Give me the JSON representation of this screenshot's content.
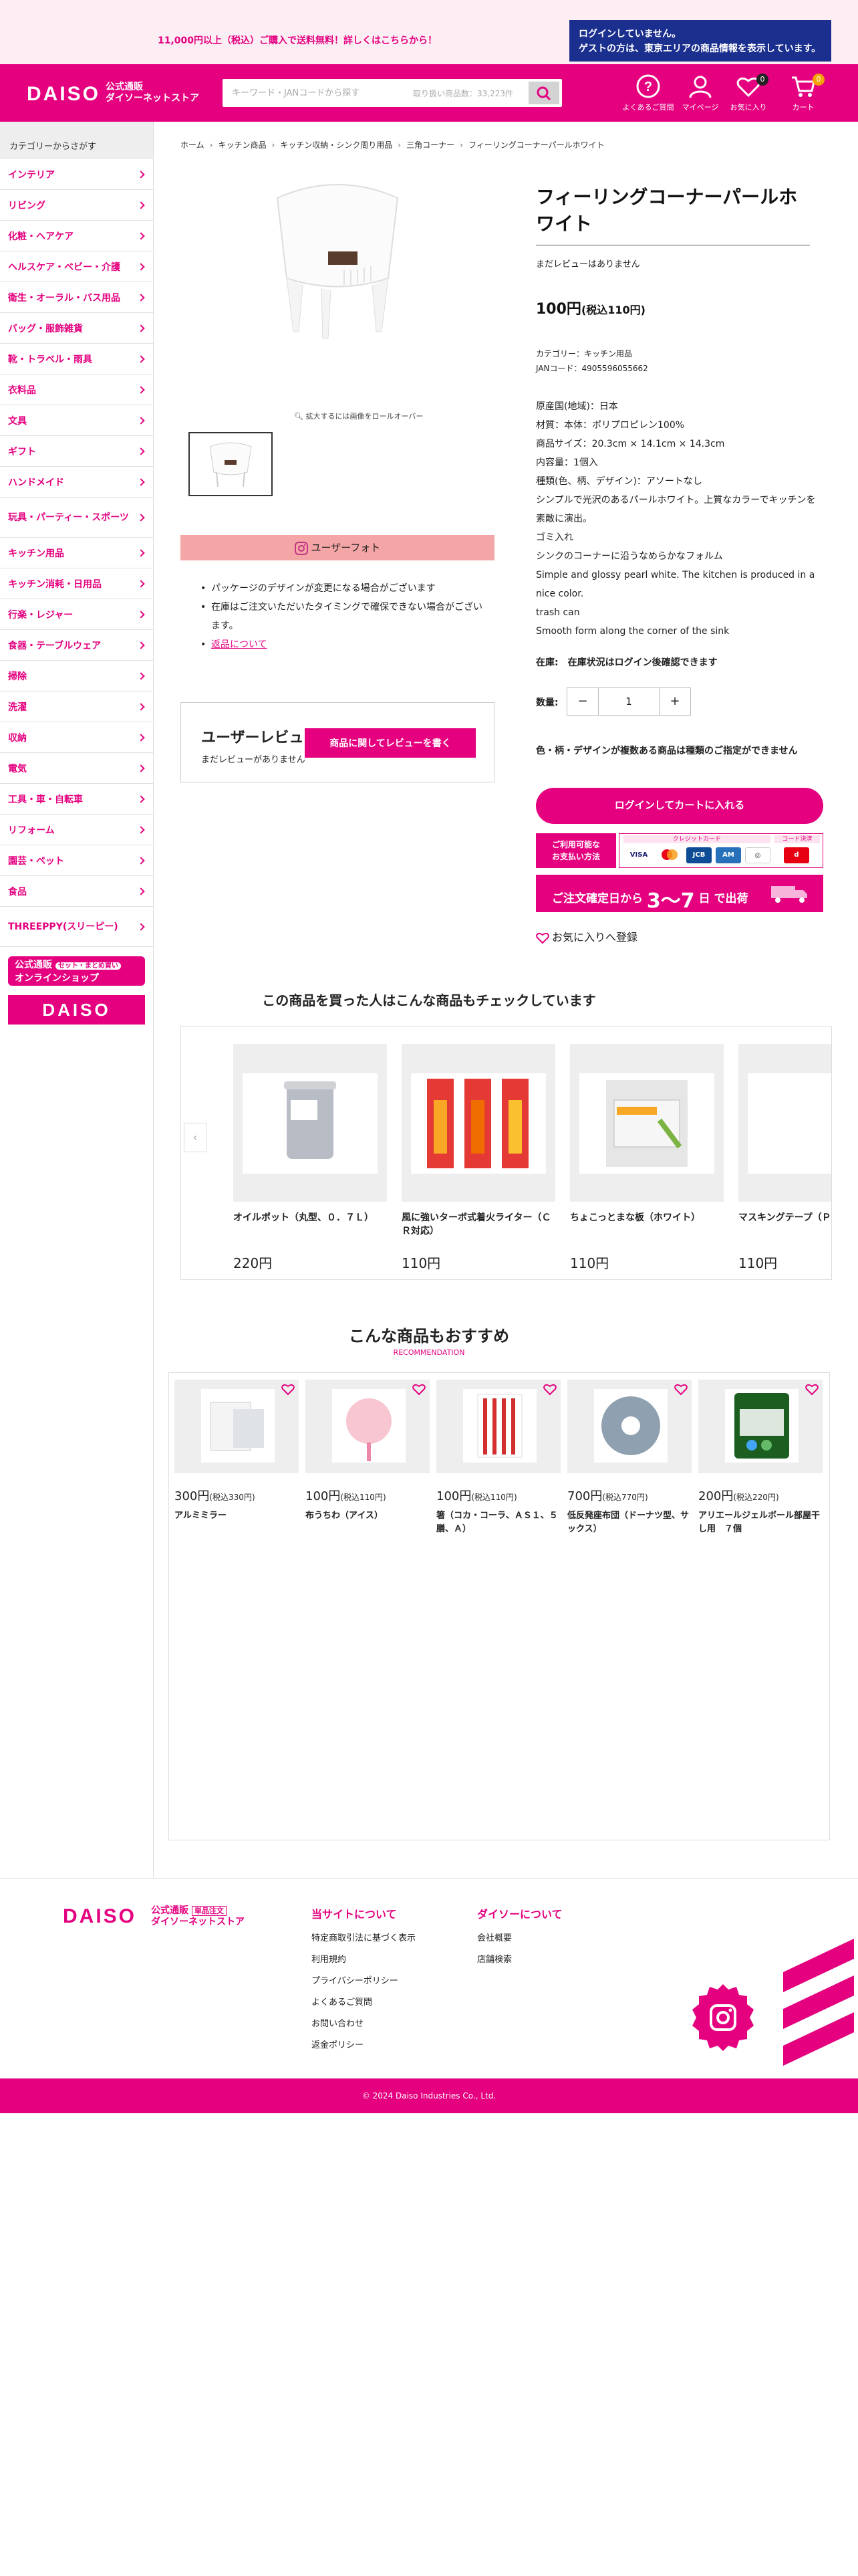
{
  "notice": {
    "shipping": "11,000円以上（税込）ご購入で送料無料！詳しくはこちらから！",
    "login_line1": "ログインしていません。",
    "login_line2": "ゲストの方は、東京エリアの商品情報を表示しています。"
  },
  "header": {
    "logo": "DAISO",
    "logo_sub1": "公式通販",
    "logo_sub2": "ダイソーネットストア",
    "search_placeholder": "キーワード・JANコードから探す",
    "search_hint": "取り扱い商品数：33,223件",
    "icons": [
      {
        "label": "よくあるご質問",
        "icon": "question-icon"
      },
      {
        "label": "マイページ",
        "icon": "user-icon"
      },
      {
        "label": "お気に入り",
        "icon": "heart-icon",
        "badge": "0"
      },
      {
        "label": "カート",
        "icon": "cart-icon",
        "badge": "0"
      }
    ]
  },
  "sidebar": {
    "heading": "カテゴリーからさがす",
    "items": [
      "インテリア",
      "リビング",
      "化粧・ヘアケア",
      "ヘルスケア・ベビー・介護",
      "衛生・オーラル・バス用品",
      "バッグ・服飾雑貨",
      "靴・トラベル・雨具",
      "衣料品",
      "文具",
      "ギフト",
      "ハンドメイド",
      "玩具・パーティー・スポーツ",
      "キッチン用品",
      "キッチン消耗・日用品",
      "行楽・レジャー",
      "食器・テーブルウェア",
      "掃除",
      "洗濯",
      "収納",
      "電気",
      "工具・車・自転車",
      "リフォーム",
      "園芸・ペット",
      "食品",
      "THREEPPY(スリーピー)"
    ],
    "banner1_line1": "公式通販",
    "banner1_tag": "セット・まとめ買い",
    "banner1_line2": "オンラインショップ",
    "banner2": "DAISO"
  },
  "breadcrumb": [
    "ホーム",
    "キッチン商品",
    "キッチン収納・シンク周り用品",
    "三角コーナー",
    "フィーリングコーナーパールホワイト"
  ],
  "gallery": {
    "zoom_hint": "拡大するには画像をロールオーバー",
    "user_photo": "ユーザーフォト"
  },
  "notes": {
    "item1": "パッケージのデザインが変更になる場合がございます",
    "item2": "在庫はご注文いただいたタイミングで確保できない場合がございます。",
    "link": "返品について"
  },
  "review": {
    "title": "ユーザーレビュー",
    "none": "まだレビューがありません",
    "button": "商品に関してレビューを書く"
  },
  "product": {
    "title": "フィーリングコーナーパールホワイト",
    "no_review": "まだレビューはありません",
    "price": "100円",
    "price_tax": "(税込110円)",
    "category": "カテゴリー：キッチン用品",
    "jan": "JANコード：4905596055662",
    "desc": [
      "原産国(地域)：日本",
      "材質：本体：ポリプロピレン100%",
      "商品サイズ：20.3cm × 14.1cm × 14.3cm",
      "内容量：1個入",
      "種類(色、柄、デザイン)：アソートなし",
      "シンプルで光沢のあるパールホワイト。上質なカラーでキッチンを素敵に演出。",
      "ゴミ入れ",
      "シンクのコーナーに沿うなめらかなフォルム",
      "Simple and glossy pearl white. The kitchen is produced in a nice color.",
      "trash can",
      "Smooth form along the corner of the sink"
    ],
    "stock": "在庫:　在庫状況はログイン後確認できます",
    "qty_label": "数量:",
    "qty_value": "1",
    "color_note": "色・柄・デザインが複数ある商品は種類のご指定ができません",
    "cart_button": "ログインしてカートに入れる",
    "pay_label1": "ご利用可能な",
    "pay_label2": "お支払い方法",
    "pay_credit": "クレジットカード",
    "pay_code": "コード決済",
    "ship_prefix": "ご注文確定日から",
    "ship_days": "3〜7",
    "ship_suffix": "日 で出荷",
    "fav": "お気に入りへ登録"
  },
  "cross_sell": {
    "title": "この商品を買った人はこんな商品もチェックしています",
    "items": [
      {
        "name": "オイルポット（丸型、０．７Ｌ）",
        "price": "220円"
      },
      {
        "name": "風に強いターボ式着火ライター（ＣＲ対応）",
        "price": "110円"
      },
      {
        "name": "ちょこっとまな板（ホワイト）",
        "price": "110円"
      },
      {
        "name": "マスキングテープ（ＰＡ ん）ＦＹ．",
        "price": "110円"
      }
    ]
  },
  "reco": {
    "title": "こんな商品もおすすめ",
    "subtitle": "RECOMMENDATION",
    "items": [
      {
        "price": "300円",
        "tax": "(税込330円)",
        "name": "アルミミラー"
      },
      {
        "price": "100円",
        "tax": "(税込110円)",
        "name": "布うちわ（アイス）"
      },
      {
        "price": "100円",
        "tax": "(税込110円)",
        "name": "箸（コカ・コーラ、ＡＳ１、５膳、Ａ）"
      },
      {
        "price": "700円",
        "tax": "(税込770円)",
        "name": "低反発座布団（ドーナツ型、サックス）"
      },
      {
        "price": "200円",
        "tax": "(税込220円)",
        "name": "アリエールジェルボール部屋干し用　７個"
      }
    ]
  },
  "footer": {
    "logo": "DAISO",
    "logo_sub1": "公式通販",
    "logo_tag": "単品注文",
    "logo_sub2": "ダイソーネットストア",
    "col1_title": "当サイトについて",
    "col1": [
      "特定商取引法に基づく表示",
      "利用規約",
      "プライバシーポリシー",
      "よくあるご質問",
      "お問い合わせ",
      "返金ポリシー"
    ],
    "col2_title": "ダイソーについて",
    "col2": [
      "会社概要",
      "店舗検索"
    ],
    "copyright": "© 2024 Daiso Industries Co., Ltd."
  }
}
